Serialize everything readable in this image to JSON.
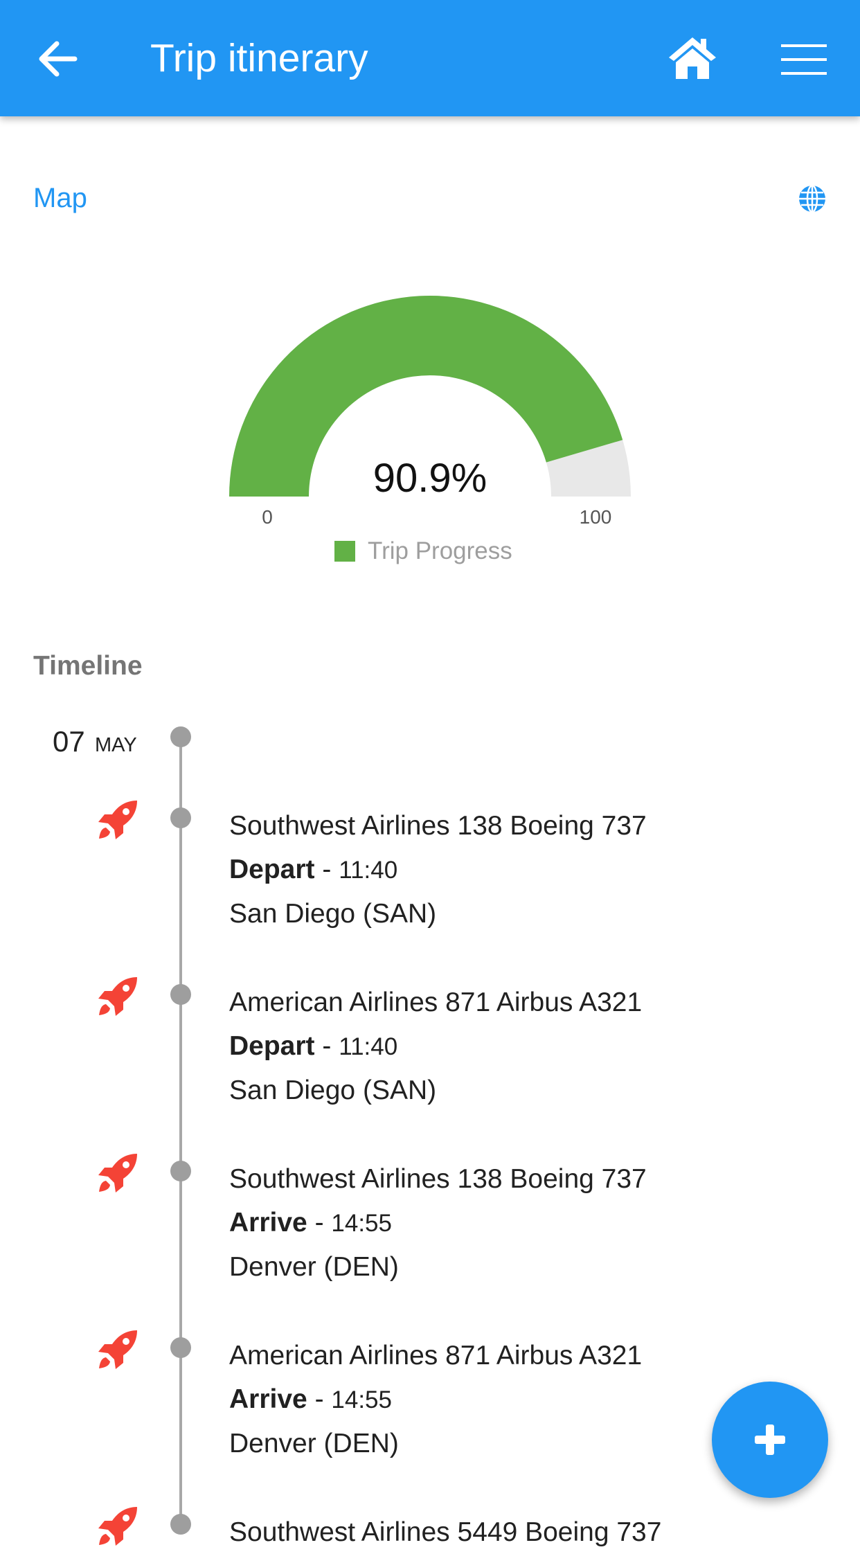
{
  "appbar": {
    "title": "Trip itinerary",
    "icons": {
      "back": "arrow-left-icon",
      "home": "home-icon",
      "menu": "menu-icon"
    },
    "color": "#2196f3"
  },
  "map": {
    "label": "Map",
    "icon": "globe-icon"
  },
  "gauge": {
    "value_text": "90.9%",
    "value": 90.9,
    "min": "0",
    "max": "100",
    "legend": "Trip Progress",
    "color": "#62b146"
  },
  "timeline": {
    "header": "Timeline",
    "date": {
      "day": "07",
      "month": "MAY"
    },
    "events": [
      {
        "flight": "Southwest Airlines 138 Boeing 737",
        "action": "Depart",
        "time": "11:40",
        "place": "San Diego (SAN)"
      },
      {
        "flight": "American Airlines 871 Airbus A321",
        "action": "Depart",
        "time": "11:40",
        "place": "San Diego (SAN)"
      },
      {
        "flight": "Southwest Airlines 138 Boeing 737",
        "action": "Arrive",
        "time": "14:55",
        "place": "Denver (DEN)"
      },
      {
        "flight": "American Airlines 871 Airbus A321",
        "action": "Arrive",
        "time": "14:55",
        "place": "Denver (DEN)"
      },
      {
        "flight": "Southwest Airlines 5449 Boeing 737",
        "action": "",
        "time": "",
        "place": ""
      }
    ],
    "event_icon": "rocket-icon",
    "event_icon_color": "#f44336"
  },
  "fab": {
    "icon": "plus-icon"
  }
}
